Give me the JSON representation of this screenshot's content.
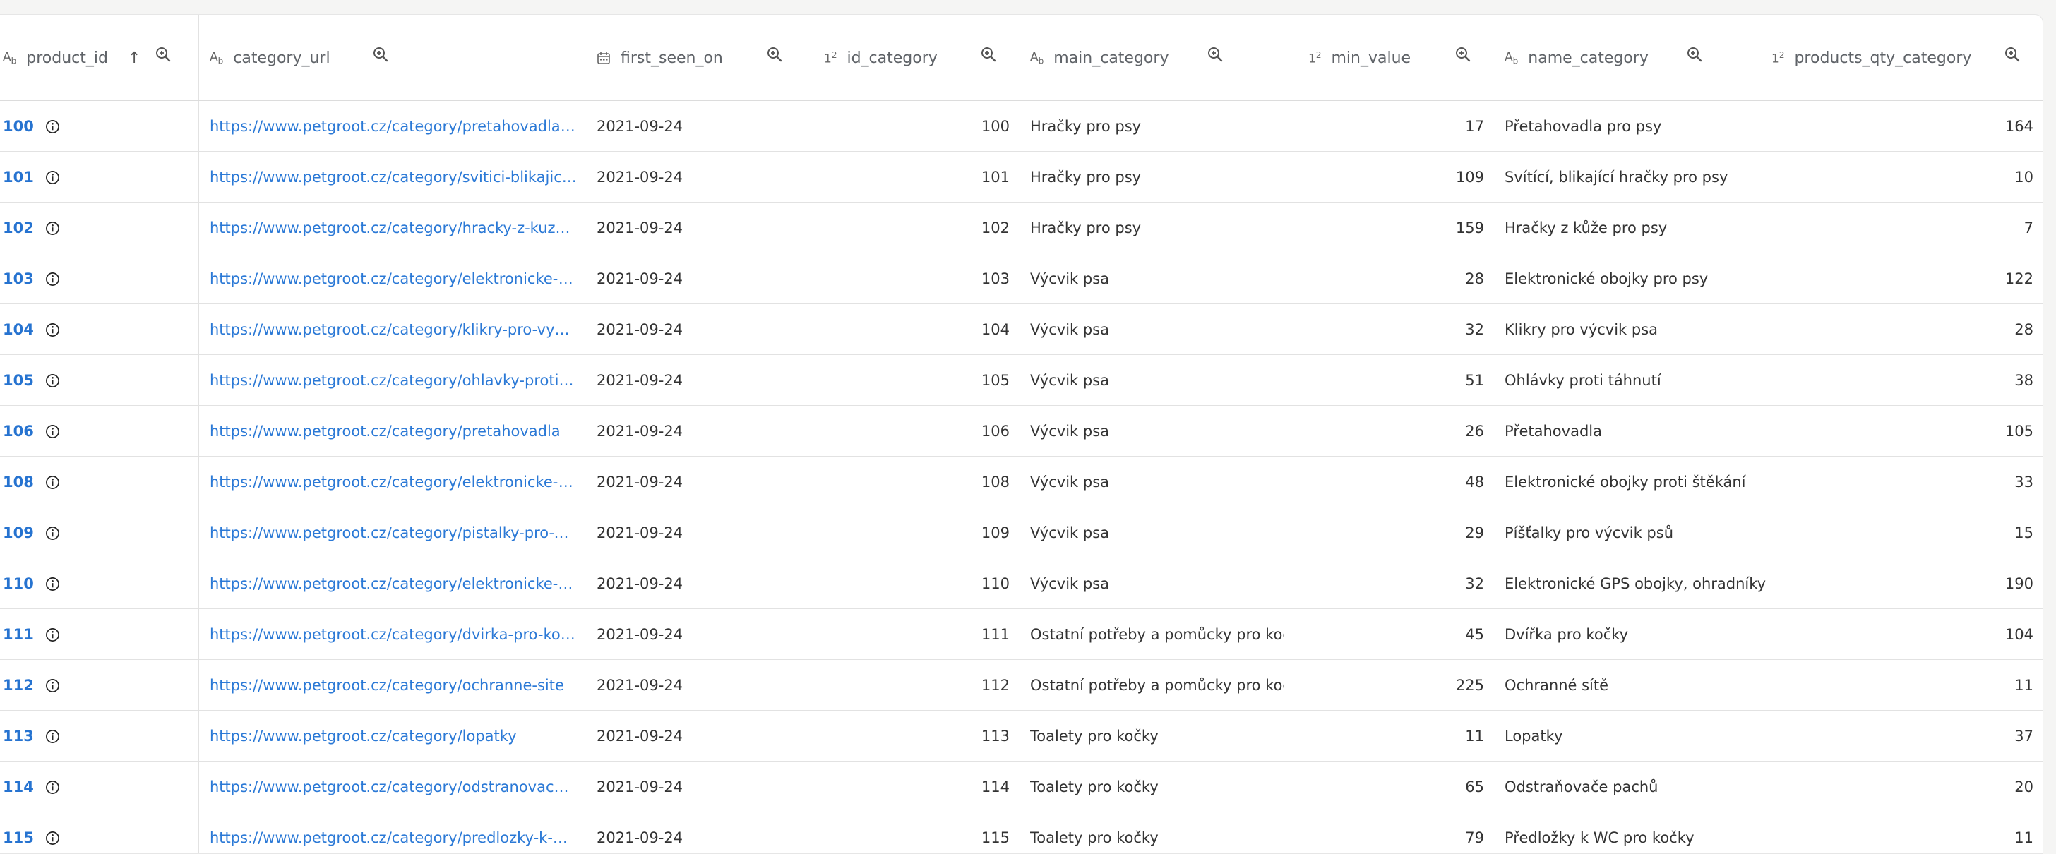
{
  "columns": [
    {
      "name": "product_id",
      "type_icon": "text-type-icon",
      "type_glyph": "A",
      "sorted": "ascending"
    },
    {
      "name": "category_url",
      "type_icon": "text-type-icon",
      "type_glyph": "A"
    },
    {
      "name": "first_seen_on",
      "type_icon": "calendar-type-icon"
    },
    {
      "name": "id_category",
      "type_icon": "number-type-icon",
      "type_glyph": "1"
    },
    {
      "name": "main_category",
      "type_icon": "text-type-icon",
      "type_glyph": "A"
    },
    {
      "name": "min_value",
      "type_icon": "number-type-icon",
      "type_glyph": "1"
    },
    {
      "name": "name_category",
      "type_icon": "text-type-icon",
      "type_glyph": "A"
    },
    {
      "name": "products_qty_category",
      "type_icon": "number-type-icon",
      "type_glyph": "1"
    }
  ],
  "type_glyphs": {
    "text_small": "b",
    "number_small": "2"
  },
  "rows": [
    {
      "product_id": "100",
      "category_url": "https://www.petgroot.cz/category/pretahovadla-pro-…",
      "first_seen_on": "2021-09-24",
      "id_category": "100",
      "main_category": "Hračky pro psy",
      "min_value": "17",
      "name_category": "Přetahovadla pro psy",
      "products_qty_category": "164"
    },
    {
      "product_id": "101",
      "category_url": "https://www.petgroot.cz/category/svitici-blikajici-hra…",
      "first_seen_on": "2021-09-24",
      "id_category": "101",
      "main_category": "Hračky pro psy",
      "min_value": "109",
      "name_category": "Svítící, blikající hračky pro psy",
      "products_qty_category": "10"
    },
    {
      "product_id": "102",
      "category_url": "https://www.petgroot.cz/category/hracky-z-kuze-pro…",
      "first_seen_on": "2021-09-24",
      "id_category": "102",
      "main_category": "Hračky pro psy",
      "min_value": "159",
      "name_category": "Hračky z kůže pro psy",
      "products_qty_category": "7"
    },
    {
      "product_id": "103",
      "category_url": "https://www.petgroot.cz/category/elektronicke-obo…",
      "first_seen_on": "2021-09-24",
      "id_category": "103",
      "main_category": "Výcvik psa",
      "min_value": "28",
      "name_category": "Elektronické obojky pro psy",
      "products_qty_category": "122"
    },
    {
      "product_id": "104",
      "category_url": "https://www.petgroot.cz/category/klikry-pro-vycvik-…",
      "first_seen_on": "2021-09-24",
      "id_category": "104",
      "main_category": "Výcvik psa",
      "min_value": "32",
      "name_category": "Klikry pro výcvik psa",
      "products_qty_category": "28"
    },
    {
      "product_id": "105",
      "category_url": "https://www.petgroot.cz/category/ohlavky-proti-tah…",
      "first_seen_on": "2021-09-24",
      "id_category": "105",
      "main_category": "Výcvik psa",
      "min_value": "51",
      "name_category": "Ohlávky proti táhnutí",
      "products_qty_category": "38"
    },
    {
      "product_id": "106",
      "category_url": "https://www.petgroot.cz/category/pretahovadla",
      "first_seen_on": "2021-09-24",
      "id_category": "106",
      "main_category": "Výcvik psa",
      "min_value": "26",
      "name_category": "Přetahovadla",
      "products_qty_category": "105"
    },
    {
      "product_id": "108",
      "category_url": "https://www.petgroot.cz/category/elektronicke-oboj…",
      "first_seen_on": "2021-09-24",
      "id_category": "108",
      "main_category": "Výcvik psa",
      "min_value": "48",
      "name_category": "Elektronické obojky proti štěkání",
      "products_qty_category": "33"
    },
    {
      "product_id": "109",
      "category_url": "https://www.petgroot.cz/category/pistalky-pro-vycvi…",
      "first_seen_on": "2021-09-24",
      "id_category": "109",
      "main_category": "Výcvik psa",
      "min_value": "29",
      "name_category": "Píšťalky pro výcvik psů",
      "products_qty_category": "15"
    },
    {
      "product_id": "110",
      "category_url": "https://www.petgroot.cz/category/elektronicke-gps-…",
      "first_seen_on": "2021-09-24",
      "id_category": "110",
      "main_category": "Výcvik psa",
      "min_value": "32",
      "name_category": "Elektronické GPS obojky, ohradníky",
      "products_qty_category": "190"
    },
    {
      "product_id": "111",
      "category_url": "https://www.petgroot.cz/category/dvirka-pro-kocky",
      "first_seen_on": "2021-09-24",
      "id_category": "111",
      "main_category": "Ostatní potřeby a pomůcky pro kočky",
      "min_value": "45",
      "name_category": "Dvířka pro kočky",
      "products_qty_category": "104"
    },
    {
      "product_id": "112",
      "category_url": "https://www.petgroot.cz/category/ochranne-site",
      "first_seen_on": "2021-09-24",
      "id_category": "112",
      "main_category": "Ostatní potřeby a pomůcky pro kočky",
      "min_value": "225",
      "name_category": "Ochranné sítě",
      "products_qty_category": "11"
    },
    {
      "product_id": "113",
      "category_url": "https://www.petgroot.cz/category/lopatky",
      "first_seen_on": "2021-09-24",
      "id_category": "113",
      "main_category": "Toalety pro kočky",
      "min_value": "11",
      "name_category": "Lopatky",
      "products_qty_category": "37"
    },
    {
      "product_id": "114",
      "category_url": "https://www.petgroot.cz/category/odstranovace-pac…",
      "first_seen_on": "2021-09-24",
      "id_category": "114",
      "main_category": "Toalety pro kočky",
      "min_value": "65",
      "name_category": "Odstraňovače pachů",
      "products_qty_category": "20"
    },
    {
      "product_id": "115",
      "category_url": "https://www.petgroot.cz/category/predlozky-k-wc-pr…",
      "first_seen_on": "2021-09-24",
      "id_category": "115",
      "main_category": "Toalety pro kočky",
      "min_value": "79",
      "name_category": "Předložky k WC pro kočky",
      "products_qty_category": "11"
    }
  ],
  "colors": {
    "link": "#2b79d6",
    "id_link": "#2673d0",
    "text": "#333333",
    "header_text": "#5f6368",
    "border": "#e2e2e2"
  }
}
